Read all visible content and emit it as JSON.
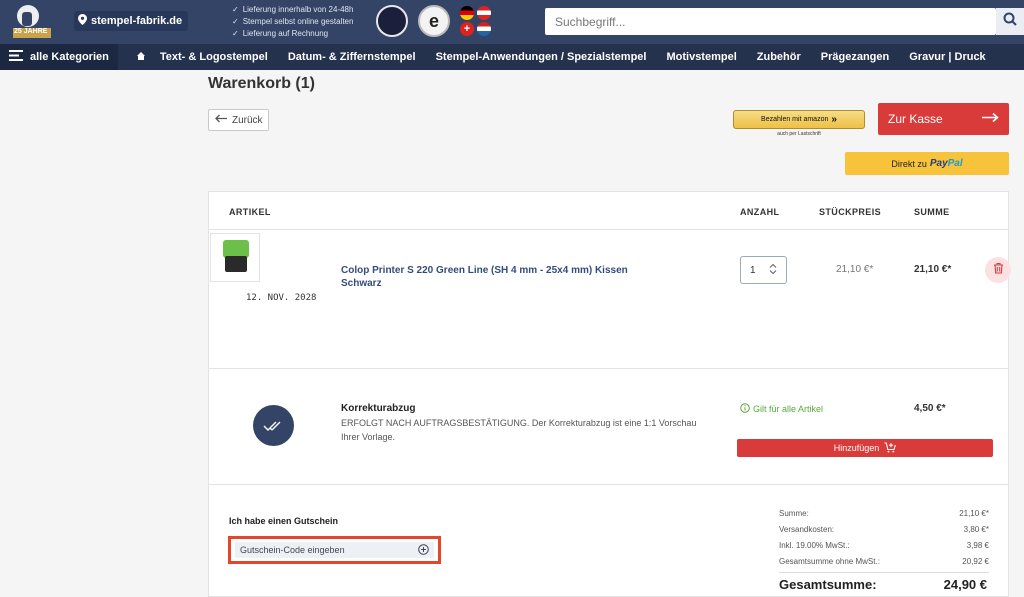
{
  "header": {
    "logo_text": "25 JAHRE",
    "domain": "stempel-fabrik.de",
    "features": [
      "Lieferung innerhalb von 24-48h",
      "Stempel selbst online gestalten",
      "Lieferung auf Rechnung"
    ],
    "search_placeholder": "Suchbegriff..."
  },
  "nav": {
    "all_categories": "alle Kategorien",
    "items": [
      "Text- & Logostempel",
      "Datum- & Ziffernstempel",
      "Stempel-Anwendungen / Spezialstempel",
      "Motivstempel",
      "Zubehör",
      "Prägezangen",
      "Gravur | Druck"
    ]
  },
  "page": {
    "title": "Warenkorb (1)",
    "back_label": "Zurück",
    "amazon_label": "Bezahlen mit amazon",
    "amazon_sub": "auch per Lastschrift",
    "checkout_label": "Zur Kasse",
    "paypal_prefix": "Direkt zu",
    "paypal_brand_a": "Pay",
    "paypal_brand_b": "Pal"
  },
  "table": {
    "headers": {
      "article": "ARTIKEL",
      "qty": "ANZAHL",
      "unit": "STÜCKPREIS",
      "sum": "SUMME"
    },
    "item": {
      "name": "Colop Printer S 220 Green Line (SH 4 mm - 25x4 mm) Kissen Schwarz",
      "date": "12. NOV. 2028",
      "qty": "1",
      "unit_price": "21,10 €*",
      "sum": "21,10 €*"
    },
    "proof": {
      "title": "Korrekturabzug",
      "description": "ERFOLGT NACH AUFTRAGSBESTÄTIGUNG. Der Korrekturabzug ist eine 1:1 Vorschau Ihrer Vorlage.",
      "valid": "Gilt für alle Artikel",
      "price": "4,50 €*",
      "add_label": "Hinzufügen"
    }
  },
  "voucher": {
    "title": "Ich habe einen Gutschein",
    "placeholder": "Gutschein-Code eingeben"
  },
  "totals": {
    "rows": [
      {
        "label": "Summe:",
        "value": "21,10 €*"
      },
      {
        "label": "Versandkosten:",
        "value": "3,80 €*"
      },
      {
        "label": "Inkl. 19.00% MwSt.:",
        "value": "3,98 €"
      },
      {
        "label": "Gesamtsumme ohne MwSt.:",
        "value": "20,92 €"
      }
    ],
    "grand_label": "Gesamtsumme:",
    "grand_value": "24,90 €"
  },
  "colors": {
    "header": "#334466",
    "nav": "#24324e",
    "accent_red": "#d93a3a",
    "paypal_yellow": "#f7c33a"
  }
}
